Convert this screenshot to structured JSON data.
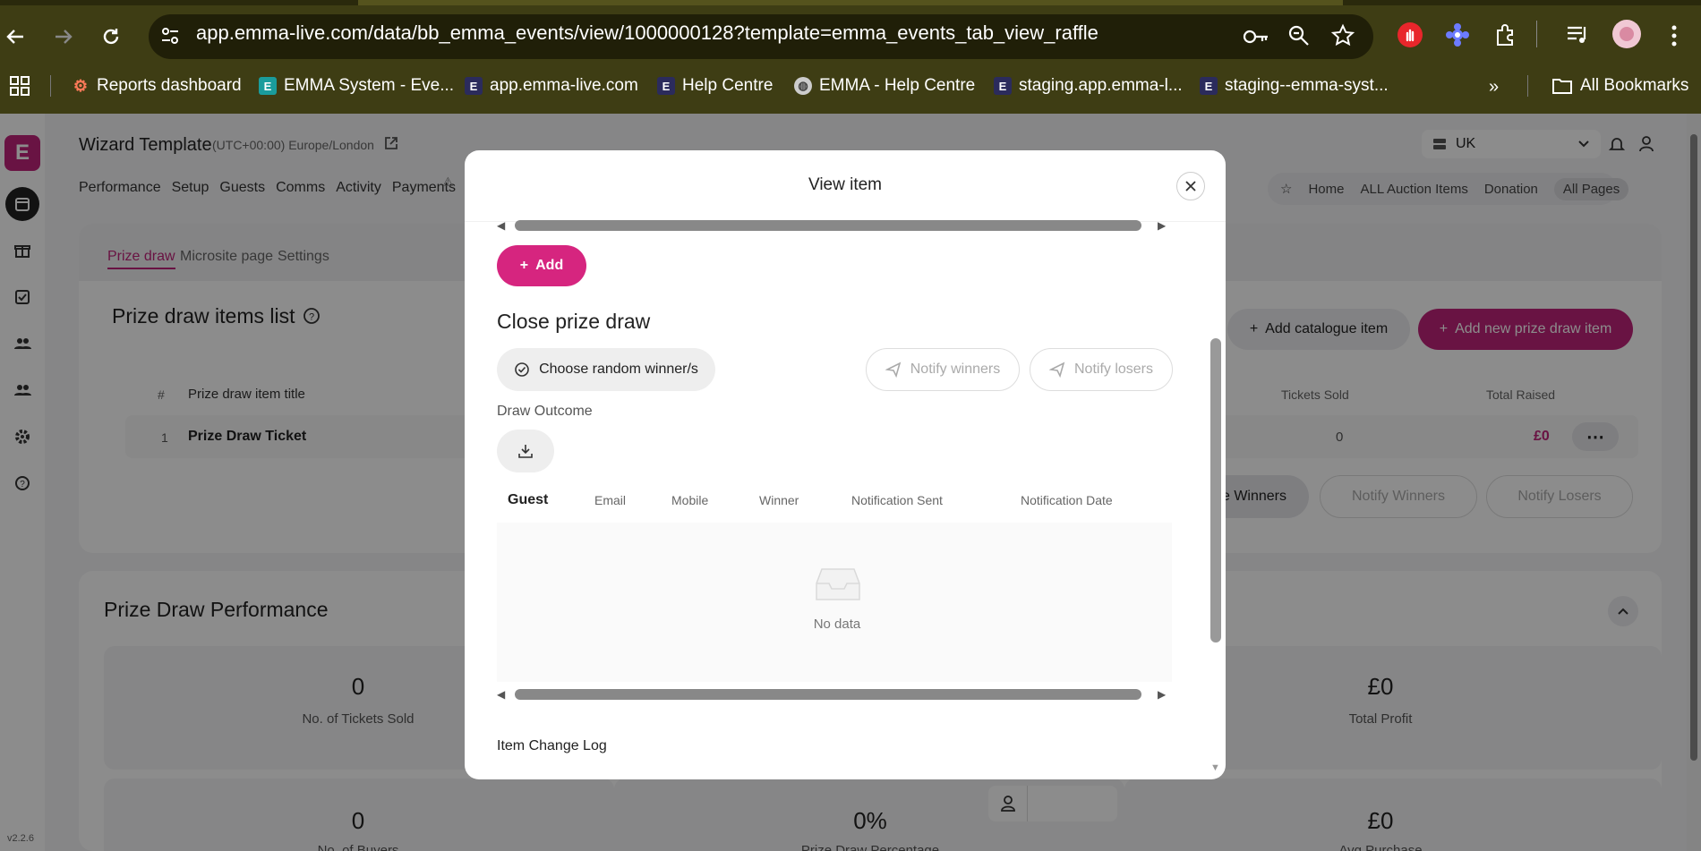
{
  "browser": {
    "url": "app.emma-live.com/data/bb_emma_events/view/1000000128?template=emma_events_tab_view_raffle",
    "bookmarks": [
      {
        "label": "Reports dashboard",
        "icon": "hubspot-icon",
        "color": "#ff7a59"
      },
      {
        "label": "EMMA System - Eve...",
        "icon": "emma-teal-icon",
        "color": "#1a9c9c"
      },
      {
        "label": "app.emma-live.com",
        "icon": "emma-icon",
        "color": "#2b2b5c"
      },
      {
        "label": "Help Centre",
        "icon": "emma-icon",
        "color": "#2b2b5c"
      },
      {
        "label": "EMMA - Help Centre",
        "icon": "globe-icon",
        "color": "#dddddd"
      },
      {
        "label": "staging.app.emma-l...",
        "icon": "emma-icon",
        "color": "#2b2b5c"
      },
      {
        "label": "staging--emma-syst...",
        "icon": "emma-icon",
        "color": "#2b2b5c"
      }
    ],
    "all_bookmarks": "All Bookmarks"
  },
  "app": {
    "logo": "E",
    "version": "v2.2.6",
    "title": "Wizard Template",
    "timezone": "(UTC+00:00) Europe/London",
    "nav": [
      "Performance",
      "Setup",
      "Guests",
      "Comms",
      "Activity",
      "Payments"
    ],
    "region": "UK",
    "quicklinks": [
      "Home",
      "ALL Auction Items",
      "Donation",
      "All Pages"
    ],
    "subtabs": [
      "Prize draw",
      "Microsite page",
      "Settings"
    ],
    "list_title": "Prize draw items list",
    "add_catalogue": "Add catalogue item",
    "add_new": "Add new prize draw item",
    "table_headers": {
      "num": "#",
      "title": "Prize draw item title",
      "sold": "Tickets Sold",
      "raised": "Total Raised"
    },
    "row": {
      "num": "1",
      "title": "Prize Draw Ticket",
      "sold": "0",
      "raised": "£0"
    },
    "bg_winners": "e Winners",
    "bg_notify_winners": "Notify Winners",
    "bg_notify_losers": "Notify Losers",
    "performance_title": "Prize Draw Performance",
    "stats": [
      {
        "value": "0",
        "label": "No. of Tickets Sold"
      },
      {
        "value": "£0",
        "label": "Total Profit"
      },
      {
        "value": "0",
        "label": "No. of Buyers"
      },
      {
        "value": "0%",
        "label": "Prize Draw Percentage"
      },
      {
        "value": "£0",
        "label": "Avg Purchase"
      }
    ]
  },
  "modal": {
    "title": "View item",
    "add_label": "Add",
    "section_title": "Close prize draw",
    "choose_random": "Choose random winner/s",
    "notify_winners": "Notify winners",
    "notify_losers": "Notify losers",
    "draw_outcome": "Draw Outcome",
    "columns": [
      "Guest",
      "Email",
      "Mobile",
      "Winner",
      "Notification Sent",
      "Notification Date"
    ],
    "empty_text": "No data",
    "change_log": "Item Change Log"
  },
  "colors": {
    "brand": "#c0237a",
    "accent": "#d6257f"
  }
}
